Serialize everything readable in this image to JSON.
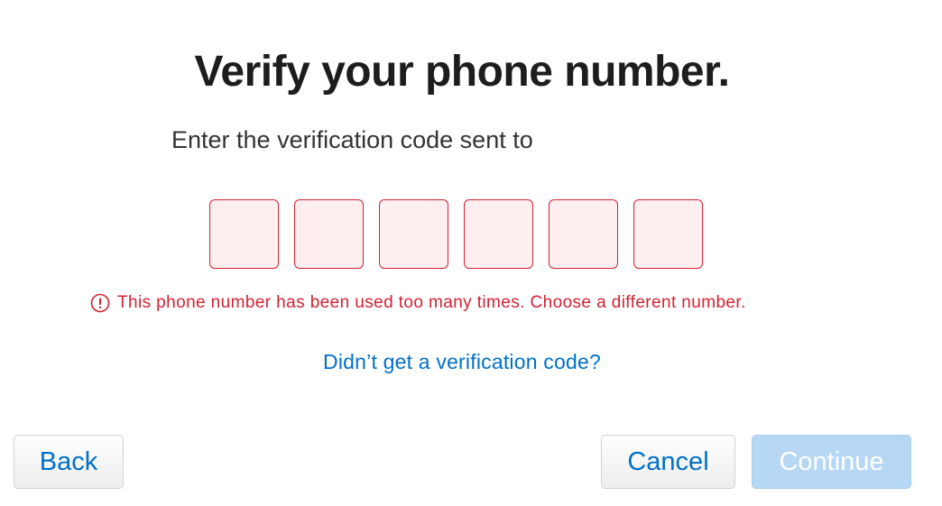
{
  "title": "Verify your phone number.",
  "subtitle": "Enter the verification code sent to",
  "code_inputs": [
    "",
    "",
    "",
    "",
    "",
    ""
  ],
  "error": {
    "icon": "exclamation-circle-icon",
    "message": "This phone number has been used too many times. Choose a different number."
  },
  "resend_link": "Didn’t get a verification code?",
  "buttons": {
    "back": "Back",
    "cancel": "Cancel",
    "continue": "Continue"
  },
  "colors": {
    "error": "#d42233",
    "link": "#0070c9",
    "error_bg": "#fdeef0",
    "continue_disabled": "#b6d8f5"
  }
}
